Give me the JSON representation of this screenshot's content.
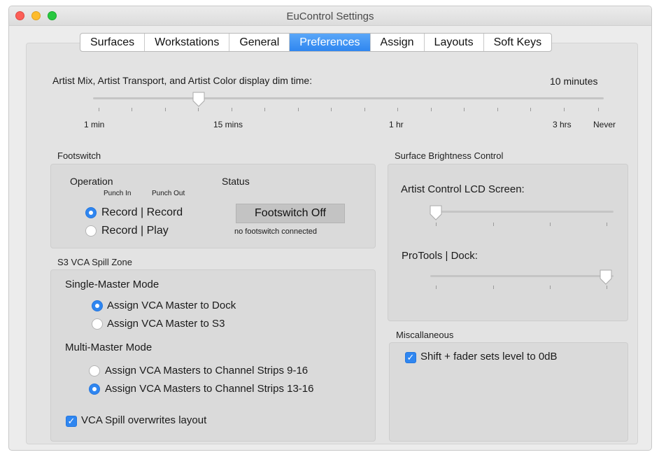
{
  "window": {
    "title": "EuControl Settings"
  },
  "tabs": [
    {
      "label": "Surfaces",
      "selected": false
    },
    {
      "label": "Workstations",
      "selected": false
    },
    {
      "label": "General",
      "selected": false
    },
    {
      "label": "Preferences",
      "selected": true
    },
    {
      "label": "Assign",
      "selected": false
    },
    {
      "label": "Layouts",
      "selected": false
    },
    {
      "label": "Soft Keys",
      "selected": false
    }
  ],
  "dim_time": {
    "label": "Artist Mix, Artist Transport, and Artist Color display dim time:",
    "value": "10 minutes",
    "tick_labels": [
      "1 min",
      "15 mins",
      "1 hr",
      "3 hrs",
      "Never"
    ]
  },
  "footswitch": {
    "title": "Footswitch",
    "operation_label": "Operation",
    "punch_in_label": "Punch In",
    "punch_out_label": "Punch Out",
    "status_label": "Status",
    "options": [
      {
        "label": "Record | Record",
        "selected": true
      },
      {
        "label": "Record | Play",
        "selected": false
      }
    ],
    "status_button": "Footswitch Off",
    "status_text": "no footswitch connected"
  },
  "vca": {
    "title": "S3 VCA Spill Zone",
    "single_master_label": "Single-Master Mode",
    "single_options": [
      {
        "label": "Assign VCA Master to Dock",
        "selected": true
      },
      {
        "label": "Assign VCA Master to S3",
        "selected": false
      }
    ],
    "multi_master_label": "Multi-Master Mode",
    "multi_options": [
      {
        "label": "Assign VCA Masters to Channel Strips 9-16",
        "selected": false
      },
      {
        "label": "Assign VCA Masters to Channel Strips 13-16",
        "selected": true
      }
    ],
    "overwrite_label": "VCA Spill overwrites layout",
    "overwrite_checked": true
  },
  "brightness": {
    "title": "Surface Brightness Control",
    "lcd_label": "Artist Control LCD Screen:",
    "dock_label": "ProTools | Dock:"
  },
  "misc": {
    "title": "Miscallaneous",
    "shift_fader_label": "Shift + fader sets level to 0dB",
    "shift_fader_checked": true
  },
  "colors": {
    "accent": "#2f86f0",
    "window_bg": "#ececec",
    "panel_bg": "#dadada"
  }
}
